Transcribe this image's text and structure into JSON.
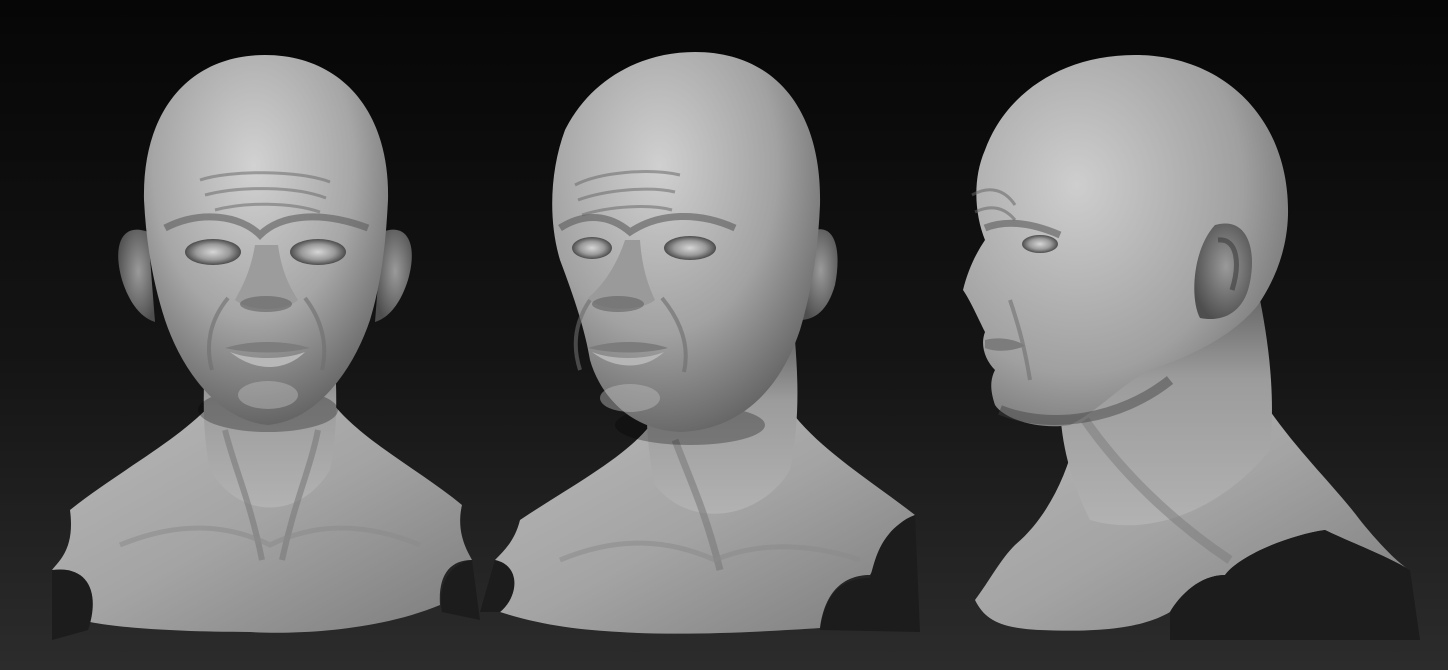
{
  "scene": {
    "background_top": "#060606",
    "background_bottom": "#2c2c2c",
    "material_light": "#c6c6c6",
    "material_mid": "#8f8f8f",
    "material_dark": "#3f3f3f",
    "views": [
      {
        "id": "front",
        "description_name": "front-view"
      },
      {
        "id": "three-quarter",
        "description_name": "three-quarter-view"
      },
      {
        "id": "profile",
        "description_name": "profile-view"
      }
    ]
  }
}
